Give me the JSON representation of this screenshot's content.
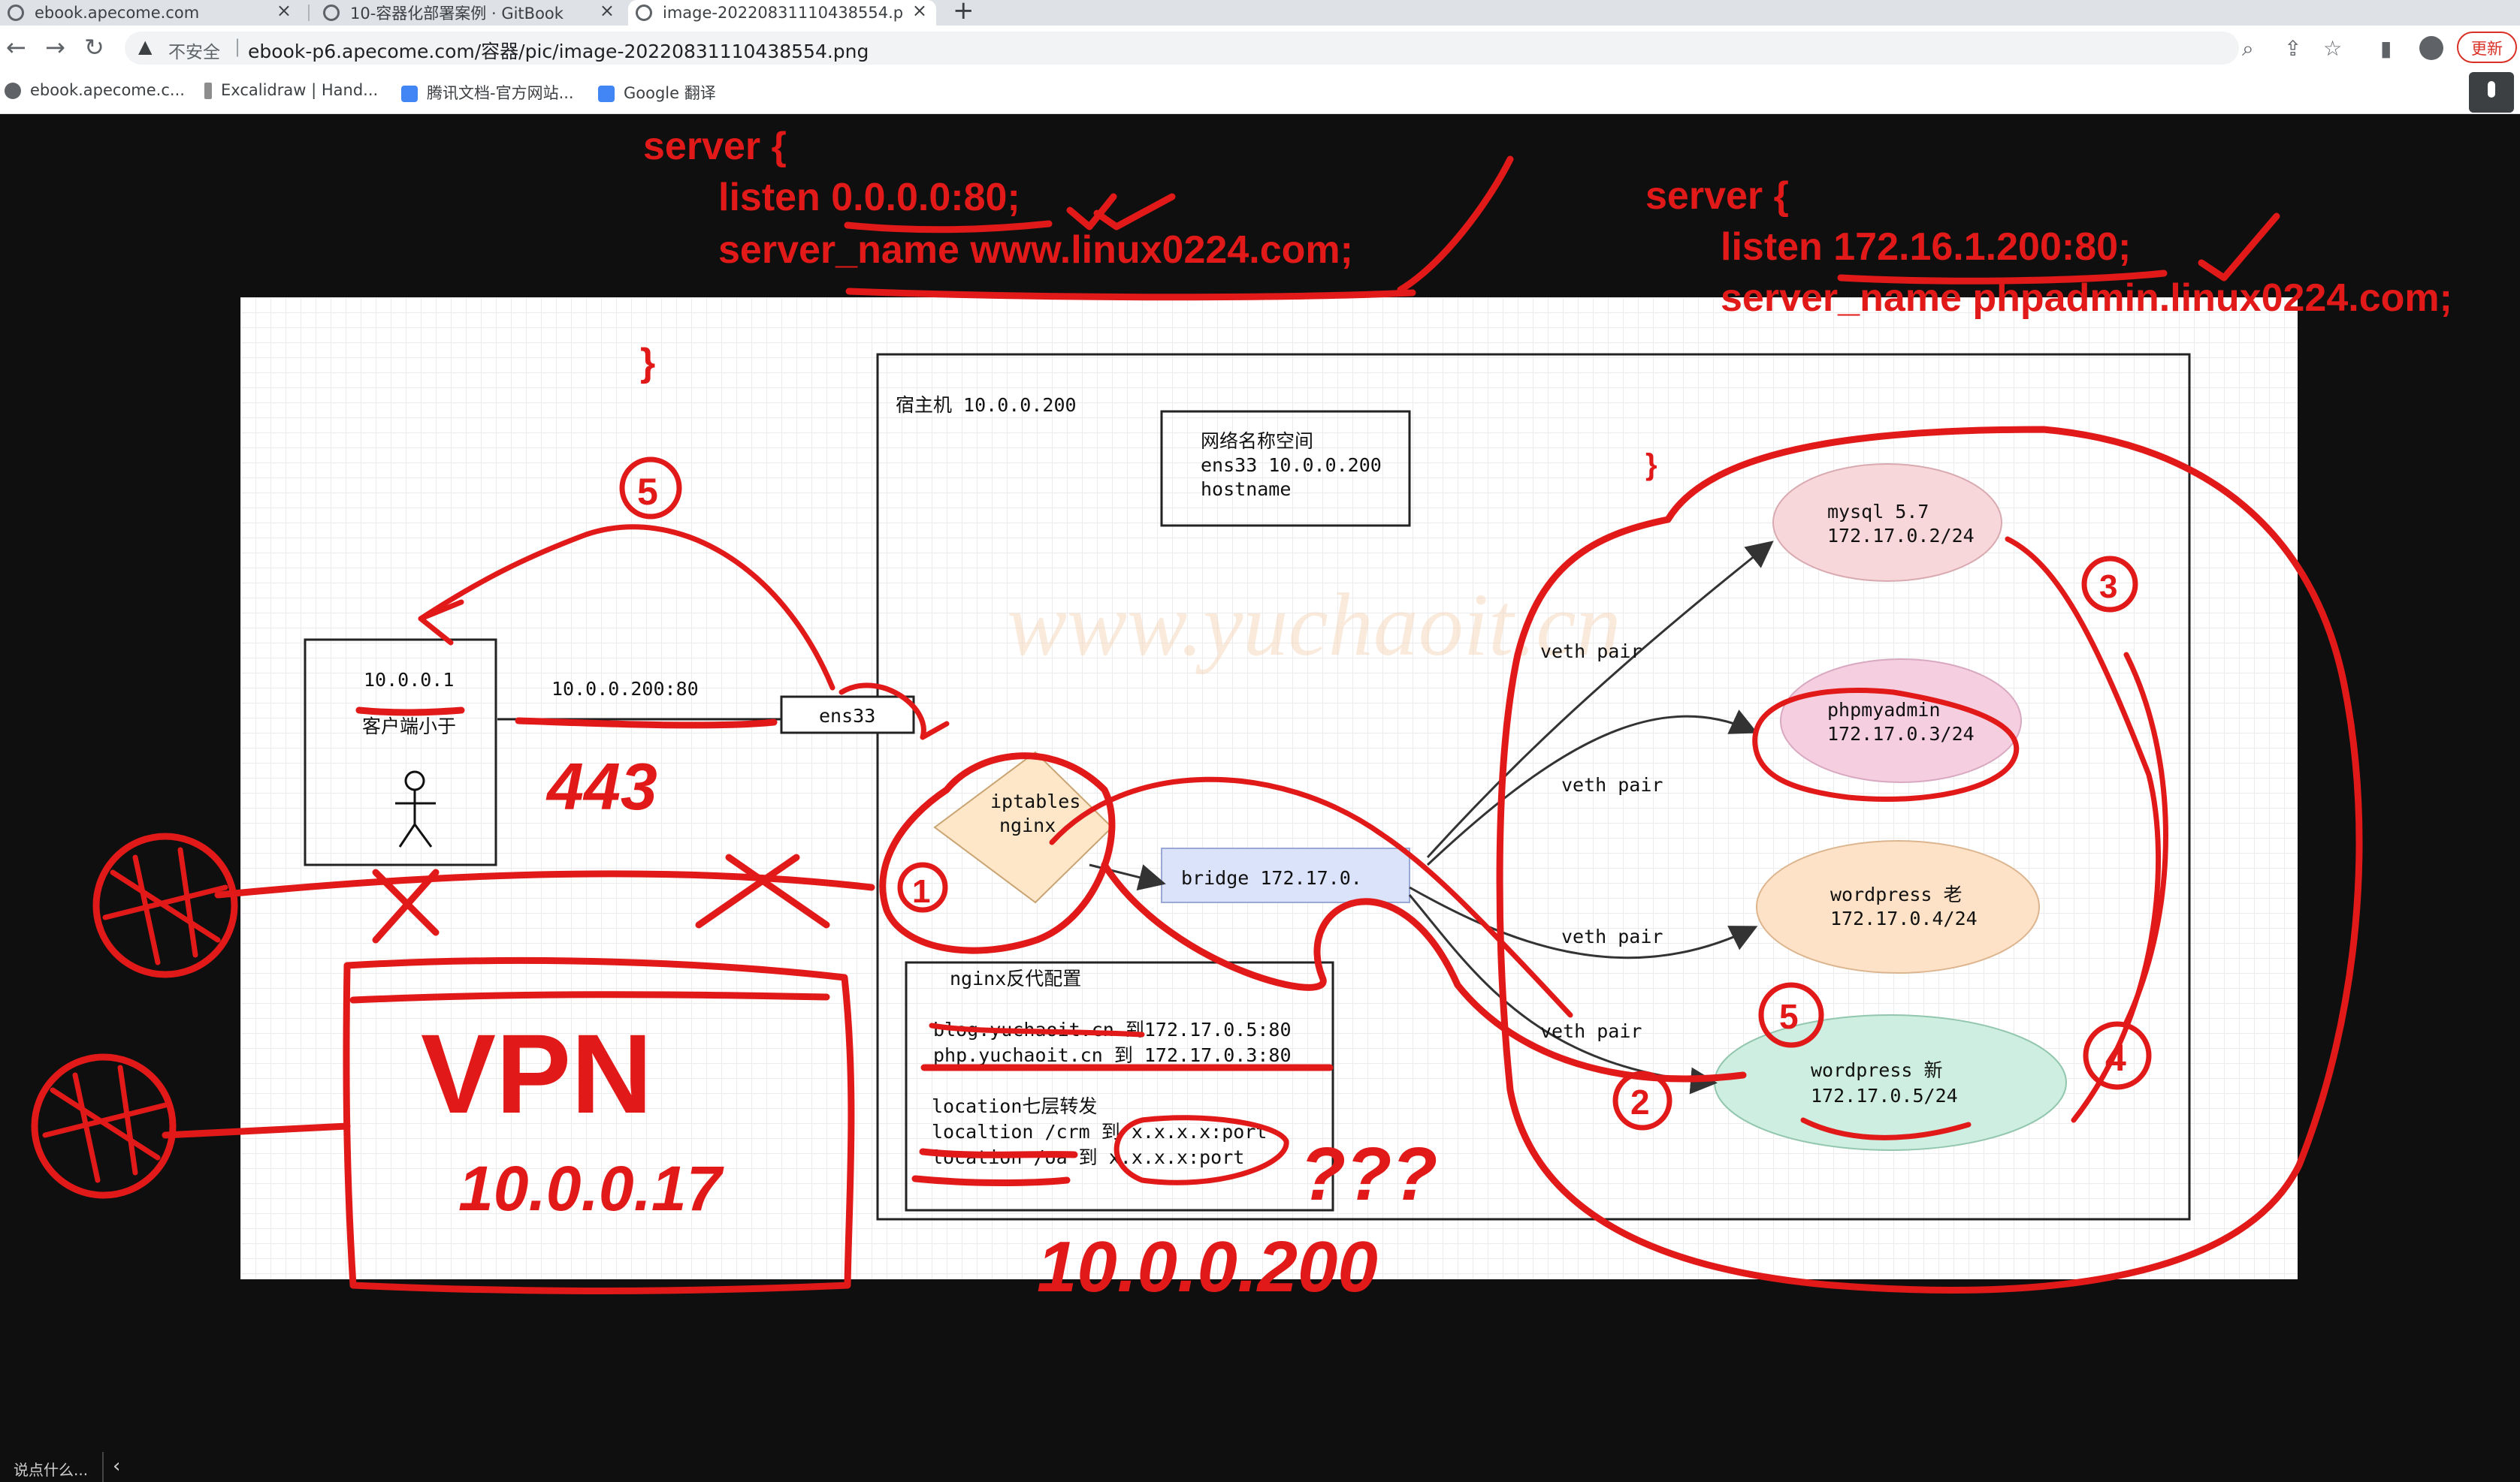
{
  "browser": {
    "tabs": [
      {
        "title": "ebook.apecome.com",
        "active": false
      },
      {
        "title": "10-容器化部署案例 · GitBook",
        "active": false
      },
      {
        "title": "image-20220831110438554.p",
        "active": true
      }
    ],
    "new_tab_label": "+",
    "security_label": "不安全",
    "url": "ebook-p6.apecome.com/容器/pic/image-20220831110438554.png",
    "update_label": "更新",
    "bookmarks": [
      {
        "label": "ebook.apecome.c..."
      },
      {
        "label": "Excalidraw | Hand..."
      },
      {
        "label": "腾讯文档-官方网站..."
      },
      {
        "label": "Google 翻译"
      }
    ]
  },
  "diagram": {
    "host_label": "宿主机 10.0.0.200",
    "netns_box": {
      "line1": "网络名称空间",
      "line2": "ens33  10.0.0.200",
      "line3": "hostname"
    },
    "client_box": {
      "ip": "10.0.0.1",
      "name": "客户端小于"
    },
    "client_link": "10.0.0.200:80",
    "ens33": "ens33",
    "iptables": "iptables",
    "nginx": "nginx",
    "bridge": "bridge  172.17.0.",
    "veth_labels": [
      "veth pair",
      "veth pair",
      "veth pair",
      "veth pair"
    ],
    "containers": [
      {
        "name": "mysql  5.7",
        "ip": "172.17.0.2/24",
        "color": "#f8d7da"
      },
      {
        "name": "phpmyadmin",
        "ip": "172.17.0.3/24",
        "color": "#f5cfe0"
      },
      {
        "name": "wordpress 老",
        "ip": "172.17.0.4/24",
        "color": "#fde2c7"
      },
      {
        "name": "wordpress 新",
        "ip": "172.17.0.5/24",
        "color": "#cdeee0"
      }
    ],
    "nginx_config": {
      "title": "nginx反代配置",
      "lines": [
        "blog.yuchaoit.cn  到172.17.0.5:80",
        "php.yuchaoit.cn  到 172.17.0.3:80"
      ],
      "l7_title": "location七层转发",
      "l7_lines": [
        "localtion /crm   到  x.x.x.x:port",
        "location /oa   到 x.x.x.x:port"
      ]
    },
    "watermark": "www.yuchaoit.cn"
  },
  "annotations": {
    "server_block_1": [
      "server {",
      "listen  0.0.0.0:80;",
      "server_name www.linux0224.com;",
      "}"
    ],
    "server_block_2": [
      "server {",
      "listen 172.16.1.200:80;",
      "server_name phpadmin.linux0224.com;",
      "}"
    ],
    "handwritten": {
      "n5": "5",
      "n443": "443",
      "n1": "1",
      "n2": "2",
      "n3": "3",
      "n4": "4",
      "n5b": "5",
      "vpn": "VPN",
      "vpn_ip": "10.0.0.17",
      "question": "???",
      "bottom_ip": "10.0.0.200"
    }
  },
  "viewer": {
    "hint": "说点什么...",
    "collapse_icon": "chevron-left-icon"
  }
}
